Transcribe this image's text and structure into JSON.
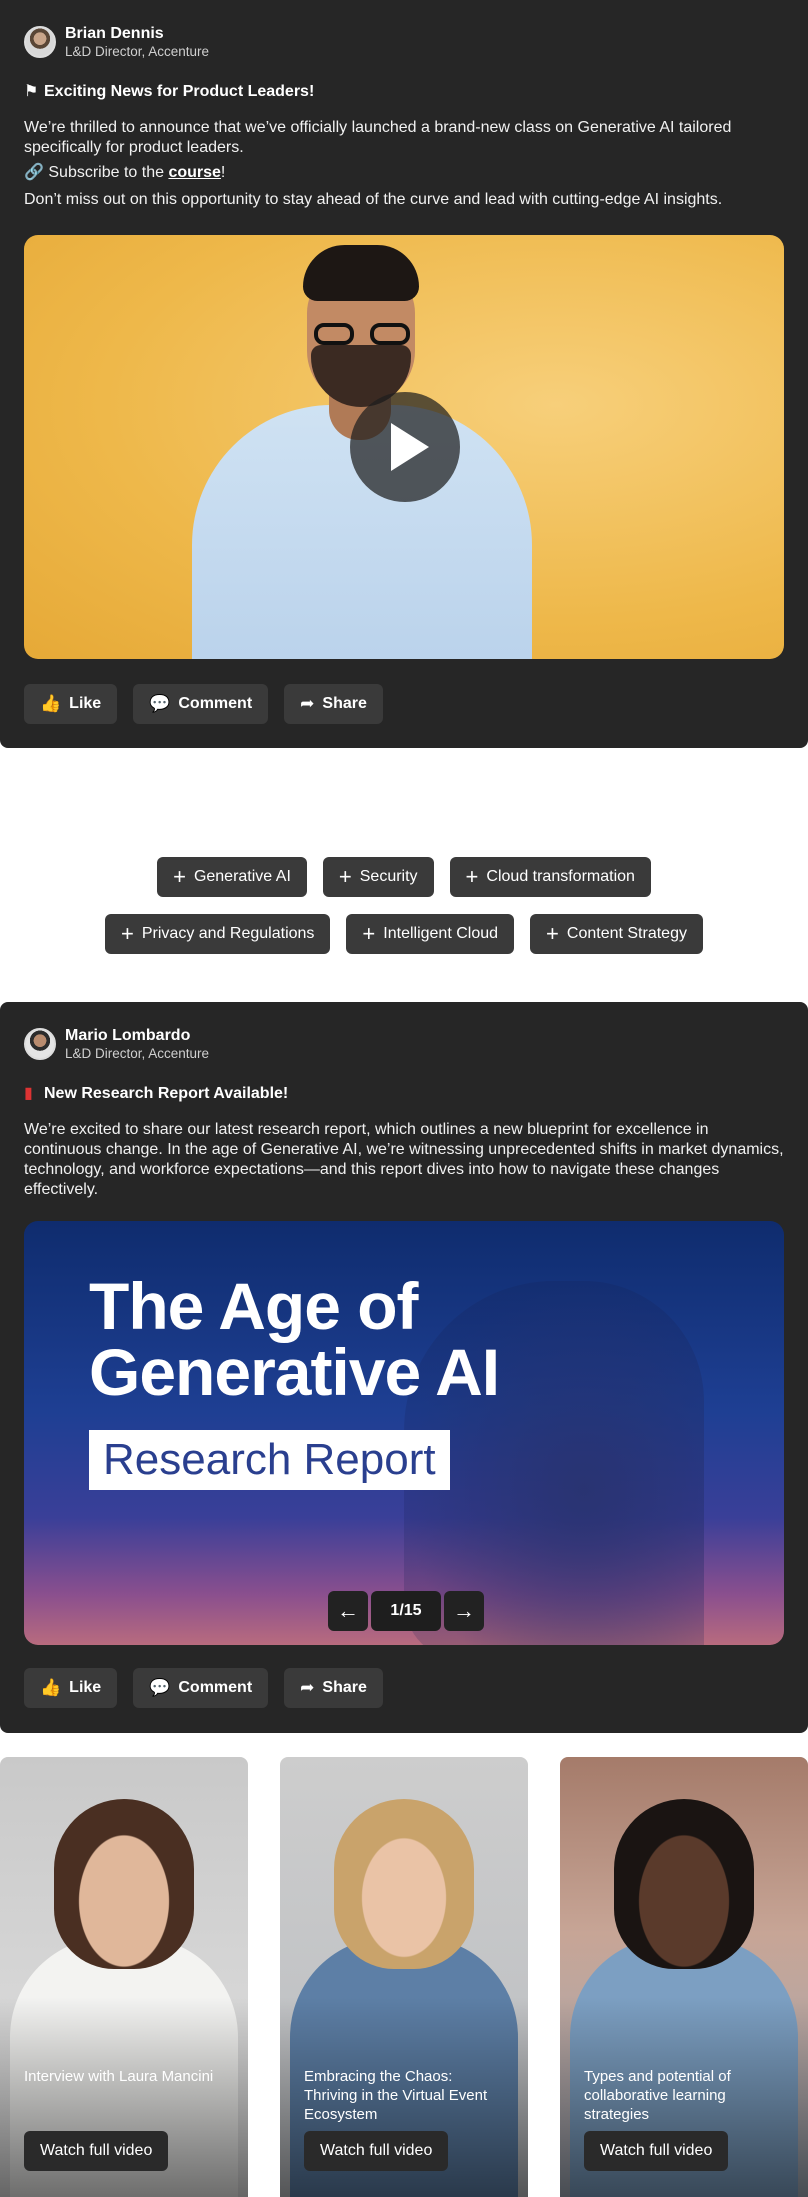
{
  "post1": {
    "author_name": "Brian Dennis",
    "author_role": "L&D Director, Accenture",
    "headline": "Exciting News for Product Leaders!",
    "headline_icon": "flag-icon",
    "paragraph1": "We’re thrilled to announce that we’ve officially launched a brand-new class on Generative AI tailored specifically for product leaders.",
    "subscribe_prefix": "Subscribe to the ",
    "subscribe_link": "course",
    "subscribe_suffix": "!",
    "paragraph3": "Don’t miss out on this opportunity to stay ahead of the curve and lead with cutting-edge AI insights.",
    "actions": {
      "like": "Like",
      "comment": "Comment",
      "share": "Share"
    }
  },
  "chips": {
    "row1": [
      "Generative AI",
      "Security",
      "Cloud transformation"
    ],
    "row2": [
      "Privacy and Regulations",
      "Intelligent Cloud",
      "Content Strategy"
    ]
  },
  "post2": {
    "author_name": "Mario Lombardo",
    "author_role": "L&D Director, Accenture",
    "headline": "New Research Report Available!",
    "headline_icon": "book-icon",
    "paragraph1": "We’re excited to share our latest research report, which outlines a new blueprint for excellence in continuous change. In the age of Generative AI, we’re witnessing unprecedented shifts in market dynamics, technology, and workforce expectations—and this report dives into how to navigate these changes effectively.",
    "slide_title_line1": "The Age of",
    "slide_title_line2": "Generative AI",
    "slide_subtitle": "Research Report",
    "pager": "1/15",
    "actions": {
      "like": "Like",
      "comment": "Comment",
      "share": "Share"
    }
  },
  "videos": [
    {
      "title": "Interview with Laura Mancini",
      "button": "Watch full video"
    },
    {
      "title": "Embracing the Chaos: Thriving in the Virtual Event Ecosystem",
      "button": "Watch full video"
    },
    {
      "title": "Types and potential of collaborative learning strategies",
      "button": "Watch full video"
    }
  ]
}
